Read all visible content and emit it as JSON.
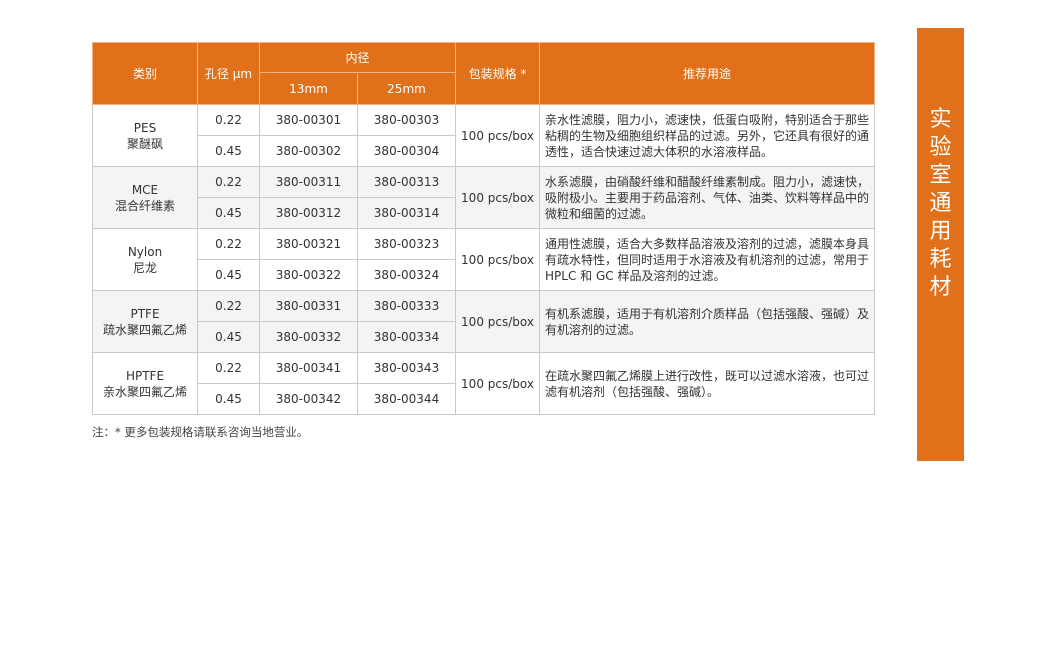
{
  "table": {
    "headers": {
      "category": "类别",
      "pore": "孔径 μm",
      "inner_diameter": "内径",
      "d13": "13mm",
      "d25": "25mm",
      "package": "包装规格 *",
      "usage": "推荐用途"
    },
    "groups": [
      {
        "name_en": "PES",
        "name_cn": "聚醚砜",
        "package": "100 pcs/box",
        "usage": "亲水性滤膜，阻力小，滤速快，低蛋白吸附，特别适合于那些粘稠的生物及细胞组织样品的过滤。另外，它还具有很好的通透性，适合快速过滤大体积的水溶液样品。",
        "rows": [
          {
            "pore": "0.22",
            "d13": "380-00301",
            "d25": "380-00303"
          },
          {
            "pore": "0.45",
            "d13": "380-00302",
            "d25": "380-00304"
          }
        ]
      },
      {
        "name_en": "MCE",
        "name_cn": "混合纤维素",
        "package": "100 pcs/box",
        "usage": "水系滤膜，由硝酸纤维和醋酸纤维素制成。阻力小，滤速快，吸附极小。主要用于药品溶剂、气体、油类、饮料等样品中的微粒和细菌的过滤。",
        "rows": [
          {
            "pore": "0.22",
            "d13": "380-00311",
            "d25": "380-00313"
          },
          {
            "pore": "0.45",
            "d13": "380-00312",
            "d25": "380-00314"
          }
        ]
      },
      {
        "name_en": "Nylon",
        "name_cn": "尼龙",
        "package": "100 pcs/box",
        "usage": "通用性滤膜，适合大多数样品溶液及溶剂的过滤，滤膜本身具有疏水特性，但同时适用于水溶液及有机溶剂的过滤，常用于 HPLC 和 GC 样品及溶剂的过滤。",
        "rows": [
          {
            "pore": "0.22",
            "d13": "380-00321",
            "d25": "380-00323"
          },
          {
            "pore": "0.45",
            "d13": "380-00322",
            "d25": "380-00324"
          }
        ]
      },
      {
        "name_en": "PTFE",
        "name_cn": "疏水聚四氟乙烯",
        "package": "100 pcs/box",
        "usage": "有机系滤膜，适用于有机溶剂介质样品（包括强酸、强碱）及有机溶剂的过滤。",
        "rows": [
          {
            "pore": "0.22",
            "d13": "380-00331",
            "d25": "380-00333"
          },
          {
            "pore": "0.45",
            "d13": "380-00332",
            "d25": "380-00334"
          }
        ]
      },
      {
        "name_en": "HPTFE",
        "name_cn": "亲水聚四氟乙烯",
        "package": "100 pcs/box",
        "usage": "在疏水聚四氟乙烯膜上进行改性，既可以过滤水溶液，也可过滤有机溶剂（包括强酸、强碱）。",
        "rows": [
          {
            "pore": "0.22",
            "d13": "380-00341",
            "d25": "380-00343"
          },
          {
            "pore": "0.45",
            "d13": "380-00342",
            "d25": "380-00344"
          }
        ]
      }
    ]
  },
  "note": "注：* 更多包装规格请联系咨询当地营业。",
  "side_tab": {
    "chars": [
      "实",
      "验",
      "室",
      "通",
      "用",
      "耗",
      "材"
    ]
  },
  "colors": {
    "accent": "#e0701a",
    "row_shade": "#f3f5f4"
  }
}
